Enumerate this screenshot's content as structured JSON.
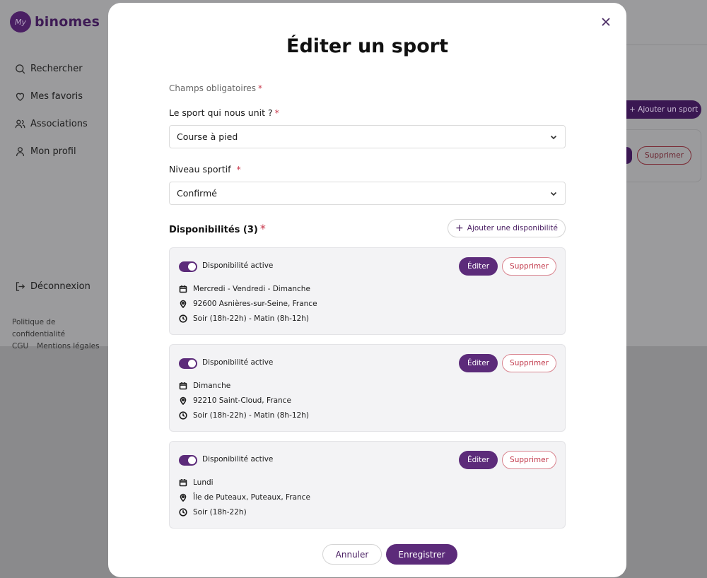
{
  "brand": {
    "mark": "My",
    "name": "binomes"
  },
  "nav": {
    "items": [
      {
        "label": "Rechercher",
        "icon": "search-icon"
      },
      {
        "label": "Mes favoris",
        "icon": "heart-icon"
      },
      {
        "label": "Associations",
        "icon": "users-icon"
      },
      {
        "label": "Mon profil",
        "icon": "user-icon"
      }
    ],
    "logout": "Déconnexion"
  },
  "footer": {
    "privacy": "Politique de confidentialité",
    "cgu": "CGU",
    "legal": "Mentions légales"
  },
  "background": {
    "add_sport": "+ Ajouter un sport",
    "delete": "Supprimer"
  },
  "modal": {
    "title": "Éditer un sport",
    "required_note": "Champs obligatoires",
    "required_mark": "*",
    "sport_label": "Le sport qui nous unit ?",
    "sport_value": "Course à pied",
    "level_label": "Niveau sportif",
    "level_value": "Confirmé",
    "dispo_title": "Disponibilités (3)",
    "add_dispo": "Ajouter une disponibilité",
    "dispos": [
      {
        "active_label": "Disponibilité active",
        "edit": "Éditer",
        "delete": "Supprimer",
        "days": "Mercredi - Vendredi - Dimanche",
        "location": "92600 Asnières-sur-Seine, France",
        "time": "Soir (18h-22h) - Matin (8h-12h)"
      },
      {
        "active_label": "Disponibilité active",
        "edit": "Éditer",
        "delete": "Supprimer",
        "days": "Dimanche",
        "location": "92210 Saint-Cloud, France",
        "time": "Soir (18h-22h) - Matin (8h-12h)"
      },
      {
        "active_label": "Disponibilité active",
        "edit": "Éditer",
        "delete": "Supprimer",
        "days": "Lundi",
        "location": "Île de Puteaux, Puteaux, France",
        "time": "Soir (18h-22h)"
      }
    ],
    "cancel": "Annuler",
    "save": "Enregistrer"
  },
  "colors": {
    "accent": "#5c2b7a",
    "danger": "#c23a4c",
    "overlay": "#8a8a8c"
  }
}
